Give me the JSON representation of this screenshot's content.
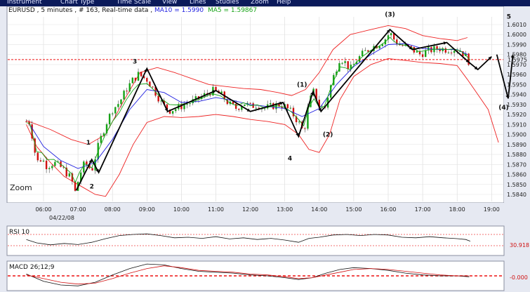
{
  "menu": {
    "items": [
      "Instrument",
      "Chart Type",
      "Time Scale",
      "View",
      "Lines",
      "Studies",
      "Zoom",
      "Help"
    ]
  },
  "colors": {
    "menu_bg": "#0b1a5a",
    "plot_bg": "#ffffff",
    "frame_bg": "#e6e9f2",
    "bull": "#17a317",
    "bear": "#d01010",
    "band": "#ee2222",
    "ma10": "#1e1ee0",
    "ma5": "#17a317",
    "dashed": "#ee1111",
    "zigzag": "#000000"
  },
  "header": {
    "prefix": "EURUSD , 5 minutes , # 163, Real-time data , ",
    "ma10_label": "MA10 = 1.5990",
    "ma5_label": "MA5 = 1.59867"
  },
  "chart_data": {
    "type": "candlestick",
    "symbol": "EURUSD",
    "interval": "5 minutes",
    "date": "04/22/08",
    "x_ticks": [
      "06:00",
      "07:00",
      "08:00",
      "09:00",
      "10:00",
      "11:00",
      "12:00",
      "13:00",
      "14:00",
      "15:00",
      "16:00",
      "17:00",
      "18:00",
      "19:00"
    ],
    "y_ticks": [
      "1.6010",
      "1.6000",
      "1.5990",
      "1.5980",
      "1.5970",
      "1.5960",
      "1.5950",
      "1.5940",
      "1.5930",
      "1.5920",
      "1.5910",
      "1.5900",
      "1.5890",
      "1.5880",
      "1.5870",
      "1.5860",
      "1.5850",
      "1.5840"
    ],
    "ylim": [
      1.5836,
      1.6017
    ],
    "current_price_label": "1.5975",
    "current_price": 1.5975,
    "price_path": [
      [
        5.5,
        1.5913
      ],
      [
        5.6,
        1.5912
      ],
      [
        5.7,
        1.5893
      ],
      [
        5.8,
        1.5872
      ],
      [
        5.95,
        1.5876
      ],
      [
        6.1,
        1.5868
      ],
      [
        6.3,
        1.5872
      ],
      [
        6.55,
        1.5866
      ],
      [
        6.8,
        1.5856
      ],
      [
        6.92,
        1.5842
      ],
      [
        7.05,
        1.586
      ],
      [
        7.2,
        1.5872
      ],
      [
        7.4,
        1.5864
      ],
      [
        7.6,
        1.589
      ],
      [
        7.8,
        1.591
      ],
      [
        8.0,
        1.5925
      ],
      [
        8.2,
        1.5932
      ],
      [
        8.4,
        1.5945
      ],
      [
        8.6,
        1.5955
      ],
      [
        8.75,
        1.596
      ],
      [
        8.85,
        1.5958
      ],
      [
        9.0,
        1.5955
      ],
      [
        9.2,
        1.5945
      ],
      [
        9.45,
        1.593
      ],
      [
        9.65,
        1.5924
      ],
      [
        9.85,
        1.5926
      ],
      [
        10.1,
        1.593
      ],
      [
        10.4,
        1.5934
      ],
      [
        10.7,
        1.594
      ],
      [
        10.9,
        1.5944
      ],
      [
        11.15,
        1.594
      ],
      [
        11.4,
        1.593
      ],
      [
        11.6,
        1.5926
      ],
      [
        11.8,
        1.5932
      ],
      [
        12.0,
        1.5928
      ],
      [
        12.2,
        1.593
      ],
      [
        12.4,
        1.5926
      ],
      [
        12.6,
        1.5928
      ],
      [
        12.8,
        1.593
      ],
      [
        13.0,
        1.5928
      ],
      [
        13.2,
        1.5922
      ],
      [
        13.4,
        1.5912
      ],
      [
        13.55,
        1.5902
      ],
      [
        13.7,
        1.5932
      ],
      [
        13.85,
        1.5944
      ],
      [
        14.0,
        1.5928
      ],
      [
        14.15,
        1.5925
      ],
      [
        14.3,
        1.5945
      ],
      [
        14.45,
        1.5962
      ],
      [
        14.6,
        1.5977
      ],
      [
        14.75,
        1.5972
      ],
      [
        14.9,
        1.5965
      ],
      [
        15.1,
        1.5975
      ],
      [
        15.3,
        1.5982
      ],
      [
        15.5,
        1.5987
      ],
      [
        15.7,
        1.599
      ],
      [
        15.9,
        1.5995
      ],
      [
        16.05,
        1.6002
      ],
      [
        16.15,
        1.5996
      ],
      [
        16.3,
        1.599
      ],
      [
        16.5,
        1.5988
      ],
      [
        16.7,
        1.5985
      ],
      [
        16.9,
        1.598
      ],
      [
        17.1,
        1.5983
      ],
      [
        17.3,
        1.5985
      ],
      [
        17.5,
        1.5986
      ],
      [
        17.7,
        1.5985
      ],
      [
        17.9,
        1.5986
      ],
      [
        18.1,
        1.5984
      ],
      [
        18.25,
        1.5978
      ],
      [
        18.38,
        1.5971
      ]
    ],
    "bollinger_upper": [
      [
        5.5,
        1.5914
      ],
      [
        6.2,
        1.5905
      ],
      [
        6.8,
        1.5895
      ],
      [
        7.3,
        1.589
      ],
      [
        7.8,
        1.59
      ],
      [
        8.3,
        1.5932
      ],
      [
        8.8,
        1.5962
      ],
      [
        9.3,
        1.5967
      ],
      [
        9.8,
        1.5962
      ],
      [
        10.3,
        1.5956
      ],
      [
        10.8,
        1.595
      ],
      [
        11.3,
        1.5948
      ],
      [
        11.8,
        1.5946
      ],
      [
        12.3,
        1.5945
      ],
      [
        12.8,
        1.5942
      ],
      [
        13.2,
        1.5939
      ],
      [
        13.6,
        1.5945
      ],
      [
        14.0,
        1.5962
      ],
      [
        14.4,
        1.5985
      ],
      [
        14.9,
        1.6
      ],
      [
        15.5,
        1.6005
      ],
      [
        16.0,
        1.6009
      ],
      [
        16.5,
        1.6006
      ],
      [
        17.0,
        1.5999
      ],
      [
        17.5,
        1.5996
      ],
      [
        18.0,
        1.5994
      ],
      [
        18.3,
        1.5997
      ]
    ],
    "bollinger_lower": [
      [
        5.5,
        1.591
      ],
      [
        5.8,
        1.5888
      ],
      [
        6.2,
        1.5872
      ],
      [
        6.6,
        1.5858
      ],
      [
        7.0,
        1.585
      ],
      [
        7.5,
        1.584
      ],
      [
        7.8,
        1.5838
      ],
      [
        8.2,
        1.586
      ],
      [
        8.6,
        1.589
      ],
      [
        9.0,
        1.5912
      ],
      [
        9.5,
        1.5918
      ],
      [
        10.0,
        1.5917
      ],
      [
        10.5,
        1.5918
      ],
      [
        11.0,
        1.592
      ],
      [
        11.5,
        1.5918
      ],
      [
        12.0,
        1.5915
      ],
      [
        12.5,
        1.5913
      ],
      [
        13.0,
        1.591
      ],
      [
        13.4,
        1.59
      ],
      [
        13.7,
        1.5885
      ],
      [
        14.0,
        1.5882
      ],
      [
        14.3,
        1.59
      ],
      [
        14.6,
        1.5935
      ],
      [
        15.0,
        1.5958
      ],
      [
        15.5,
        1.597
      ],
      [
        16.0,
        1.5976
      ],
      [
        16.5,
        1.5974
      ],
      [
        17.0,
        1.5972
      ],
      [
        17.5,
        1.5971
      ],
      [
        18.0,
        1.5969
      ],
      [
        18.3,
        1.5955
      ],
      [
        18.6,
        1.594
      ],
      [
        18.9,
        1.5925
      ],
      [
        19.2,
        1.5892
      ]
    ],
    "ma10_path": [
      [
        5.6,
        1.591
      ],
      [
        6.0,
        1.5888
      ],
      [
        6.5,
        1.5874
      ],
      [
        7.0,
        1.5866
      ],
      [
        7.5,
        1.5872
      ],
      [
        8.0,
        1.5895
      ],
      [
        8.5,
        1.5925
      ],
      [
        9.0,
        1.5945
      ],
      [
        9.5,
        1.5942
      ],
      [
        10.0,
        1.5932
      ],
      [
        10.5,
        1.5933
      ],
      [
        11.0,
        1.5937
      ],
      [
        11.5,
        1.5934
      ],
      [
        12.0,
        1.593
      ],
      [
        12.5,
        1.5928
      ],
      [
        13.0,
        1.5926
      ],
      [
        13.5,
        1.5918
      ],
      [
        14.0,
        1.5926
      ],
      [
        14.5,
        1.595
      ],
      [
        15.0,
        1.5968
      ],
      [
        15.5,
        1.598
      ],
      [
        16.0,
        1.599
      ],
      [
        16.5,
        1.5991
      ],
      [
        17.0,
        1.5986
      ],
      [
        17.5,
        1.5985
      ],
      [
        18.0,
        1.5985
      ],
      [
        18.3,
        1.598
      ]
    ],
    "annotations": [
      {
        "text": "(3)",
        "x": 16.05,
        "y": 1.6018
      },
      {
        "text": "5",
        "x": 19.5,
        "y": 1.6016
      },
      {
        "text": "3",
        "x": 8.65,
        "y": 1.5971
      },
      {
        "text": "(1)",
        "x": 13.5,
        "y": 1.5948
      },
      {
        "text": "(4)",
        "x": 19.35,
        "y": 1.5925
      },
      {
        "text": "1",
        "x": 7.3,
        "y": 1.589
      },
      {
        "text": "(2)",
        "x": 14.25,
        "y": 1.5898
      },
      {
        "text": "4",
        "x": 13.15,
        "y": 1.5874
      },
      {
        "text": "2",
        "x": 7.4,
        "y": 1.5846
      }
    ],
    "wave_zigzag": [
      [
        6.95,
        1.5844
      ],
      [
        7.4,
        1.5875
      ],
      [
        7.6,
        1.5862
      ],
      [
        9.0,
        1.5966
      ],
      [
        9.6,
        1.5923
      ],
      [
        11.0,
        1.5944
      ],
      [
        12.0,
        1.5923
      ],
      [
        12.95,
        1.5932
      ],
      [
        13.4,
        1.5898
      ],
      [
        13.82,
        1.5943
      ],
      [
        14.05,
        1.5923
      ],
      [
        16.05,
        1.6005
      ],
      [
        16.7,
        1.5985
      ],
      [
        17.7,
        1.5992
      ],
      [
        18.35,
        1.5972
      ],
      [
        18.6,
        1.5965
      ],
      [
        19.0,
        1.5978
      ]
    ],
    "wave_zigzag_2": [
      [
        19.15,
        1.598
      ],
      [
        19.48,
        1.5936
      ],
      [
        19.62,
        1.598
      ]
    ],
    "rsi": {
      "label": "RSI 10",
      "level_label": "30.918",
      "levels": [
        70,
        30
      ],
      "path": [
        [
          5.5,
          52
        ],
        [
          5.8,
          40
        ],
        [
          6.2,
          33
        ],
        [
          6.6,
          38
        ],
        [
          7.0,
          34
        ],
        [
          7.4,
          42
        ],
        [
          7.8,
          55
        ],
        [
          8.2,
          66
        ],
        [
          8.6,
          70
        ],
        [
          9.0,
          72
        ],
        [
          9.4,
          66
        ],
        [
          9.8,
          58
        ],
        [
          10.2,
          60
        ],
        [
          10.6,
          56
        ],
        [
          11.0,
          62
        ],
        [
          11.4,
          54
        ],
        [
          11.8,
          58
        ],
        [
          12.2,
          52
        ],
        [
          12.6,
          56
        ],
        [
          13.0,
          50
        ],
        [
          13.4,
          42
        ],
        [
          13.7,
          56
        ],
        [
          14.0,
          60
        ],
        [
          14.4,
          68
        ],
        [
          14.8,
          70
        ],
        [
          15.2,
          66
        ],
        [
          15.6,
          70
        ],
        [
          16.0,
          68
        ],
        [
          16.4,
          60
        ],
        [
          16.8,
          58
        ],
        [
          17.2,
          62
        ],
        [
          17.6,
          58
        ],
        [
          18.0,
          55
        ],
        [
          18.25,
          52
        ],
        [
          18.38,
          46
        ]
      ]
    },
    "macd": {
      "label": "MACD 26;12;9",
      "level_label": "-0.000",
      "macd_path": [
        [
          5.5,
          0.2
        ],
        [
          6.0,
          -0.6
        ],
        [
          6.5,
          -1.0
        ],
        [
          7.0,
          -1.1
        ],
        [
          7.5,
          -0.7
        ],
        [
          8.0,
          0.1
        ],
        [
          8.5,
          0.8
        ],
        [
          9.0,
          1.3
        ],
        [
          9.5,
          1.2
        ],
        [
          10.0,
          0.8
        ],
        [
          10.5,
          0.5
        ],
        [
          11.0,
          0.4
        ],
        [
          11.5,
          0.3
        ],
        [
          12.0,
          0.1
        ],
        [
          12.5,
          0.0
        ],
        [
          13.0,
          -0.2
        ],
        [
          13.4,
          -0.4
        ],
        [
          13.8,
          -0.2
        ],
        [
          14.2,
          0.3
        ],
        [
          14.6,
          0.7
        ],
        [
          15.0,
          0.9
        ],
        [
          15.5,
          0.8
        ],
        [
          16.0,
          0.6
        ],
        [
          16.5,
          0.3
        ],
        [
          17.0,
          0.1
        ],
        [
          17.5,
          0.0
        ],
        [
          18.0,
          0.0
        ],
        [
          18.35,
          -0.1
        ]
      ],
      "signal_path": [
        [
          5.5,
          0.1
        ],
        [
          6.0,
          -0.3
        ],
        [
          6.5,
          -0.7
        ],
        [
          7.0,
          -0.9
        ],
        [
          7.5,
          -0.8
        ],
        [
          8.0,
          -0.3
        ],
        [
          8.5,
          0.3
        ],
        [
          9.0,
          0.8
        ],
        [
          9.5,
          1.1
        ],
        [
          10.0,
          0.9
        ],
        [
          10.5,
          0.6
        ],
        [
          11.0,
          0.5
        ],
        [
          11.5,
          0.4
        ],
        [
          12.0,
          0.2
        ],
        [
          12.5,
          0.1
        ],
        [
          13.0,
          -0.1
        ],
        [
          13.4,
          -0.3
        ],
        [
          13.8,
          -0.2
        ],
        [
          14.2,
          0.1
        ],
        [
          14.6,
          0.4
        ],
        [
          15.0,
          0.7
        ],
        [
          15.5,
          0.8
        ],
        [
          16.0,
          0.7
        ],
        [
          16.5,
          0.5
        ],
        [
          17.0,
          0.3
        ],
        [
          17.5,
          0.1
        ],
        [
          18.0,
          0.0
        ],
        [
          18.35,
          0.0
        ]
      ]
    }
  },
  "zoom_label": "Zoom"
}
